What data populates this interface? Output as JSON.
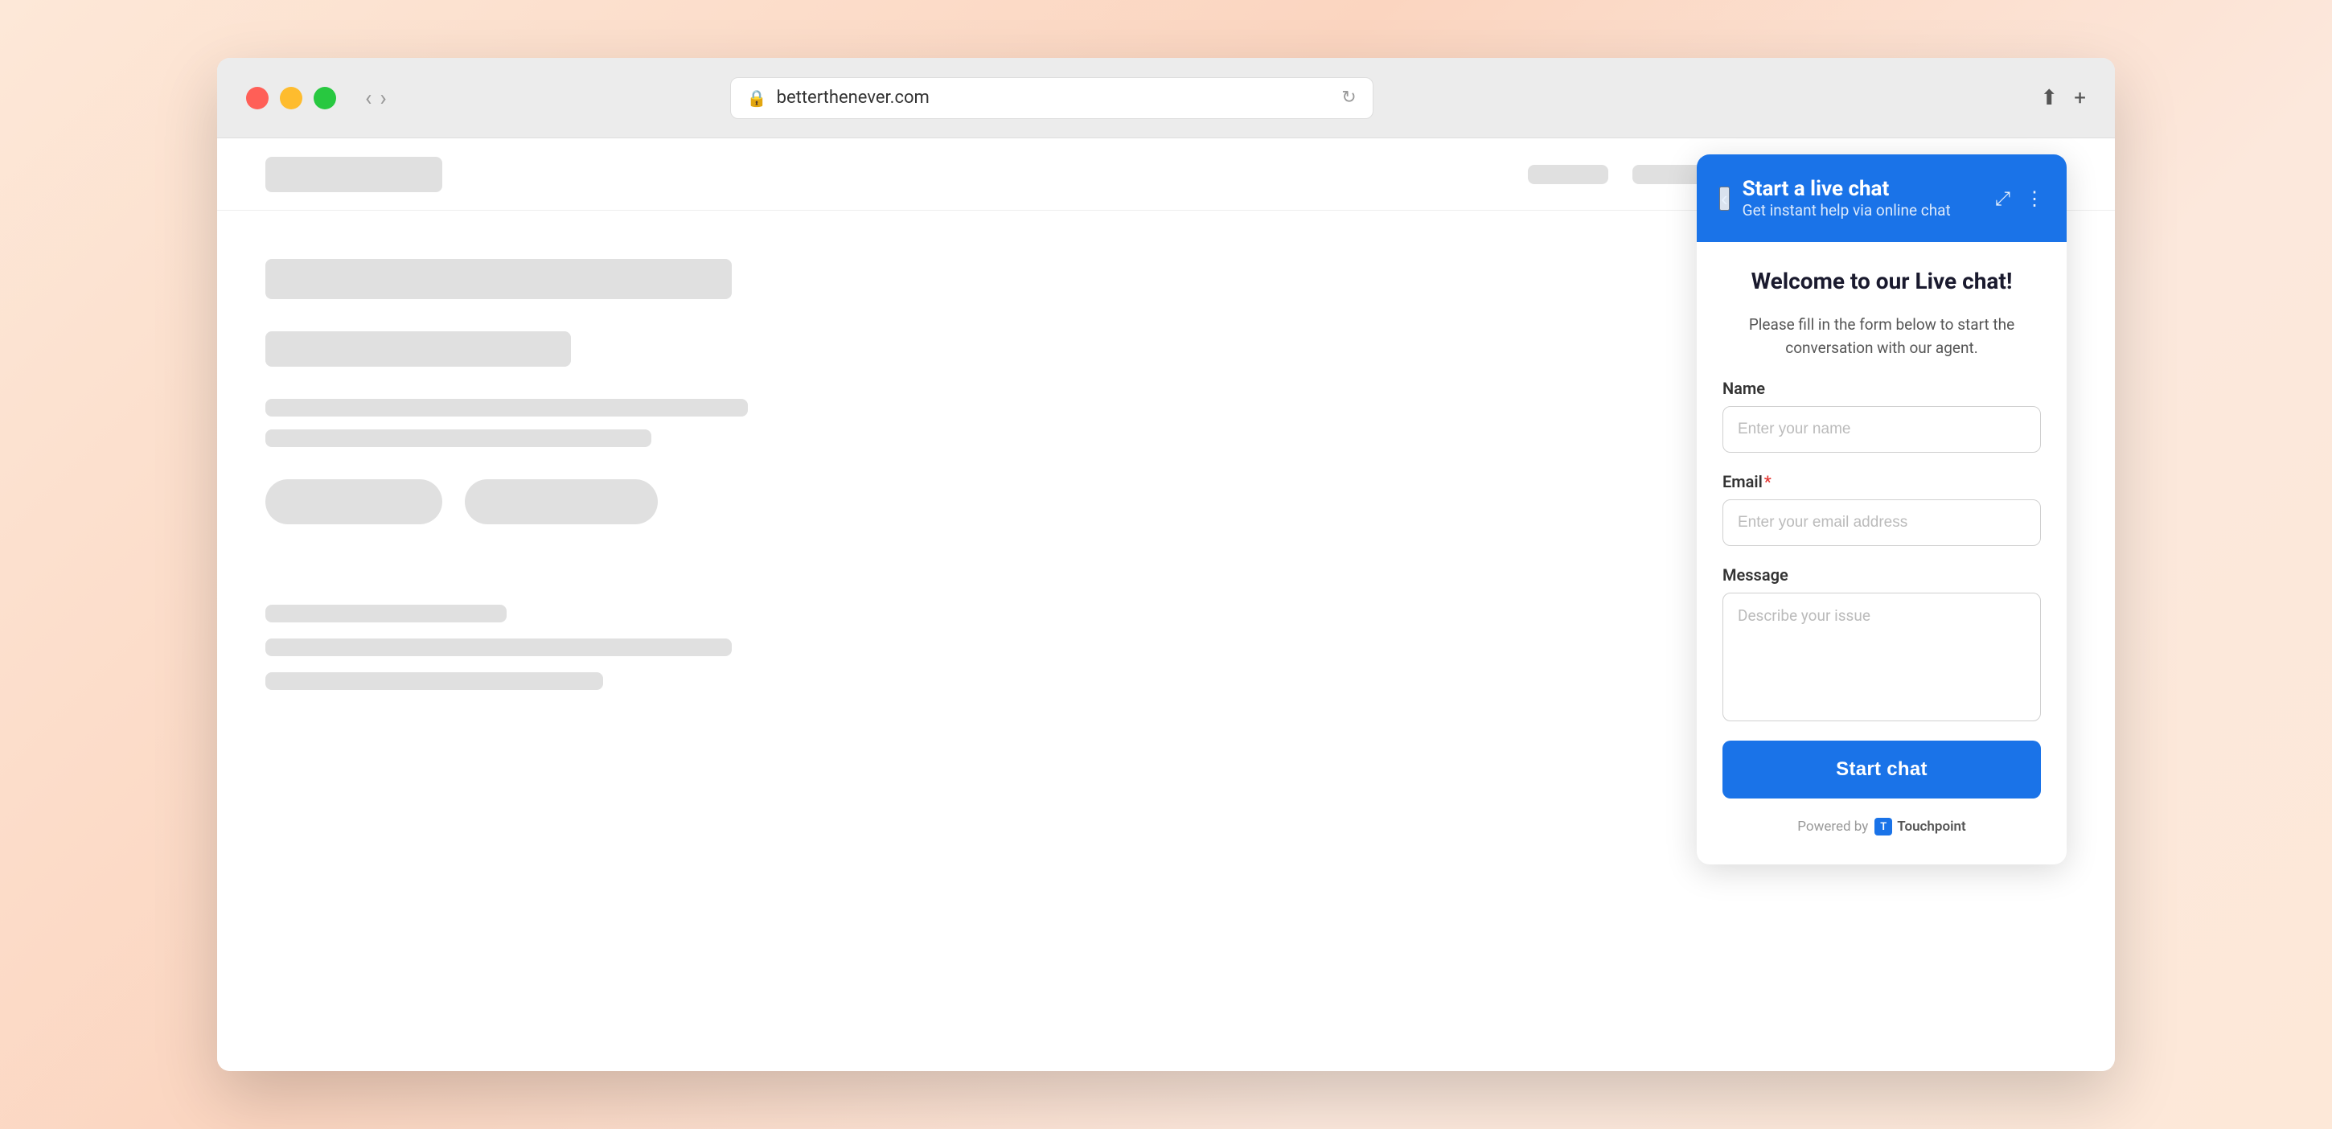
{
  "browser": {
    "url": "betterthenever.com",
    "back_label": "‹",
    "forward_label": "›",
    "lock_icon": "🔒",
    "reload_icon": "↻",
    "share_icon": "⬆",
    "new_tab_icon": "+"
  },
  "page": {
    "nav": {
      "logo_placeholder": "",
      "links": [
        {
          "width": 100
        },
        {
          "width": 120
        },
        {
          "width": 90
        },
        {
          "width": 130
        },
        {
          "width": 110
        }
      ]
    }
  },
  "chat": {
    "header": {
      "title": "Start a live chat",
      "subtitle": "Get instant help via online chat",
      "back_icon": "‹",
      "expand_icon": "⤢",
      "more_icon": "⋮"
    },
    "welcome_title": "Welcome to our Live chat!",
    "welcome_text": "Please fill in the form below to start the conversation with our agent.",
    "form": {
      "name_label": "Name",
      "name_placeholder": "Enter your name",
      "email_label": "Email",
      "email_required": "*",
      "email_placeholder": "Enter your email address",
      "message_label": "Message",
      "message_placeholder": "Describe your issue"
    },
    "start_chat_label": "Start chat",
    "powered_by_text": "Powered by",
    "powered_by_brand": "Touchpoint"
  }
}
